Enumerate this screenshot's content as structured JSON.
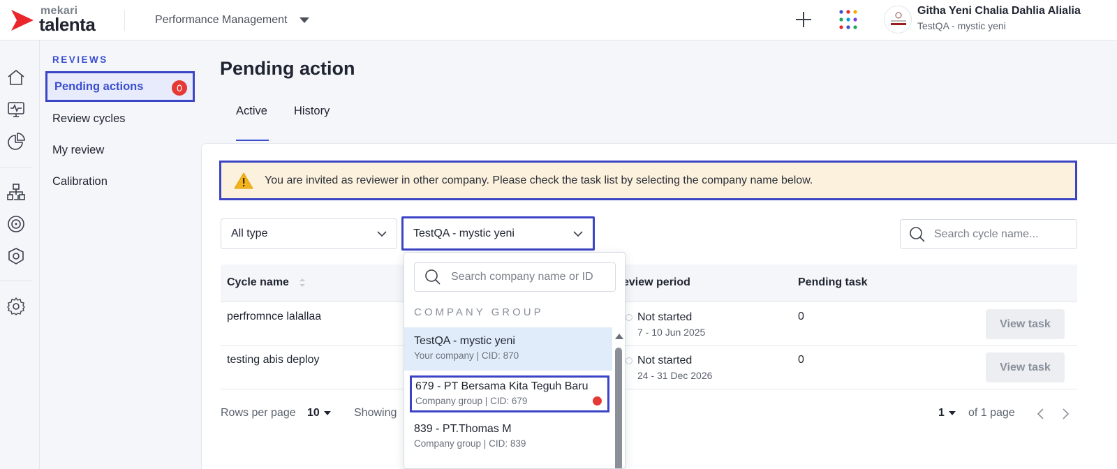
{
  "brand": {
    "top": "mekari",
    "bottom": "talenta"
  },
  "header": {
    "module": "Performance Management",
    "user_name": "Githa Yeni Chalia Dahlia Alialia",
    "user_company": "TestQA - mystic yeni",
    "icons": [
      "plus-icon",
      "apps-grid-icon",
      "avatar"
    ]
  },
  "rail_icons": [
    "home-icon",
    "monitor-pulse-icon",
    "pie-chart-icon",
    "org-chart-icon",
    "target-icon",
    "badge-icon",
    "gear-icon"
  ],
  "subnav": {
    "title": "REVIEWS",
    "items": [
      {
        "label": "Pending actions",
        "badge": "0",
        "active": true
      },
      {
        "label": "Review cycles"
      },
      {
        "label": "My review"
      },
      {
        "label": "Calibration"
      }
    ]
  },
  "main": {
    "title": "Pending action",
    "tabs": [
      {
        "label": "Active",
        "active": true
      },
      {
        "label": "History"
      }
    ],
    "alert": "You are invited as reviewer in other company. Please check the task list by selecting the company name below.",
    "filters": {
      "type": "All type",
      "company": "TestQA - mystic yeni",
      "search_placeholder": "Search cycle name..."
    },
    "table": {
      "columns": [
        "Cycle name",
        "Review period",
        "Pending task"
      ],
      "column_visible_text": [
        "Cycle name",
        "eview period",
        "Pending task"
      ],
      "rows": [
        {
          "name": "perfromnce lalallaa",
          "status": "Not started",
          "period": "7 - 10 Jun 2025",
          "pending": "0",
          "action": "View task"
        },
        {
          "name": "testing abis deploy",
          "status": "Not started",
          "period": "24 - 31 Dec 2026",
          "pending": "0",
          "action": "View task"
        }
      ]
    },
    "footer": {
      "rows_label": "Rows per page",
      "rows_value": "10",
      "showing": "Showing",
      "page": "1",
      "of_page": "of 1 page"
    }
  },
  "company_dropdown": {
    "search_placeholder": "Search company name or ID",
    "group_label": "COMPANY GROUP",
    "items": [
      {
        "name": "TestQA - mystic yeni",
        "sub": "Your company | CID: 870",
        "selected": true
      },
      {
        "name": "679 - PT Bersama Kita Teguh Baru",
        "sub": "Company group | CID: 679",
        "has_notification": true
      },
      {
        "name": "839 - PT.Thomas M",
        "sub": "Company group | CID: 839"
      }
    ]
  },
  "colors": {
    "accent": "#3a4ed0",
    "highlight_border": "#3b44c4",
    "alert_bg": "#fcf1dd",
    "badge_red": "#e53935",
    "brand_red": "#e8262b"
  }
}
